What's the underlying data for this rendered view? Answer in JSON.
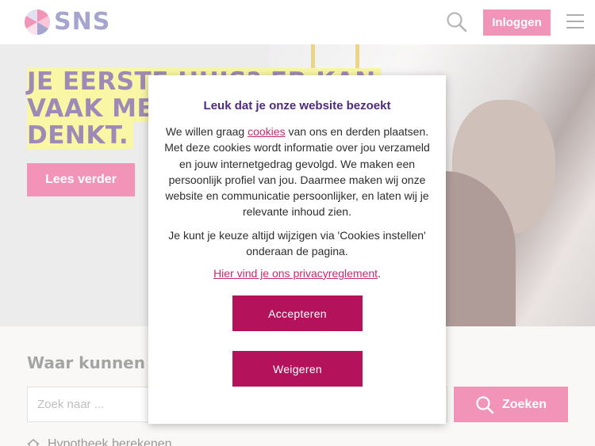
{
  "header": {
    "logo_text": "SNS",
    "login_label": "Inloggen",
    "icons": {
      "search": "search-icon",
      "menu": "hamburger-menu-icon",
      "logo": "sns-logo-icon"
    }
  },
  "hero": {
    "title_lines": [
      "JE EERSTE HUIS? ER KAN",
      "VAAK MEER",
      "DENKT."
    ],
    "read_more_label": "Lees verder"
  },
  "search": {
    "heading": "Waar kunnen we",
    "placeholder": "Zoek naar ...",
    "submit_label": "Zoeken",
    "quick_link": "Hypotheek berekenen"
  },
  "cookie_modal": {
    "title": "Leuk dat je onze website bezoekt",
    "body_prefix": "We willen graag ",
    "body_link": "cookies",
    "body_suffix": " van ons en derden plaatsen. Met deze cookies wordt informatie over jou verzameld en jouw internetgedrag gevolgd. We maken een persoonlijk profiel van jou. Daarmee maken wij onze website en communicatie persoonlijker, en laten wij je relevante inhoud zien.",
    "note": "Je kunt je keuze altijd wijzigen via 'Cookies instellen' onderaan de pagina.",
    "privacy_link": "Hier vind je ons privacyreglement",
    "privacy_suffix": ".",
    "accept_label": "Accepteren",
    "decline_label": "Weigeren"
  },
  "colors": {
    "brand_pink": "#e63d7e",
    "modal_button": "#b4135b",
    "title_purple": "#4f2b7a",
    "hero_highlight": "#f5ef5e"
  }
}
